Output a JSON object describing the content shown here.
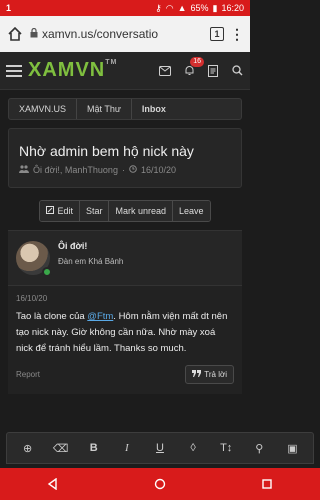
{
  "statusbar": {
    "left": "1",
    "battery": "65%",
    "time": "16:20"
  },
  "browser": {
    "url": "xamvn.us/conversatio",
    "tab_count": "1"
  },
  "header": {
    "logo": "XAMVN",
    "trademark": "TM",
    "alert_count": "16"
  },
  "breadcrumb": [
    "XAMVN.US",
    "Mật Thư",
    "Inbox"
  ],
  "conversation": {
    "title": "Nhờ admin bem hộ nick này",
    "participants": "Ôi đời!, ManhThuong",
    "date": "16/10/20"
  },
  "actions": {
    "edit": "Edit",
    "star": "Star",
    "mark_unread": "Mark unread",
    "leave": "Leave"
  },
  "post": {
    "username": "Ôi đời!",
    "rank": "Đàn em Khá Bảnh",
    "date": "16/10/20",
    "body_before": "Tao là clone của ",
    "mention": "@Ftm",
    "body_after": ". Hôm nằm viện mất dt nên tạo nick này. Giờ không cần nữa. Nhờ mày xoá nick để tránh hiểu lầm. Thanks so much.",
    "report": "Report",
    "reply": "Trả lời"
  },
  "colors": {
    "accent": "#7fbf3f",
    "status_bar": "#d81b1b",
    "mention": "#5aa9e6"
  }
}
